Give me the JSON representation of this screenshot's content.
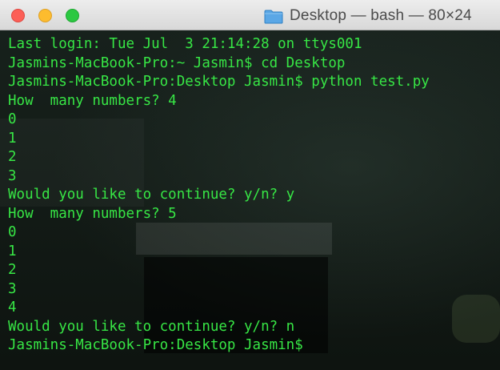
{
  "window": {
    "title": "Desktop — bash — 80×24"
  },
  "terminal": {
    "text_color": "#37e645",
    "lines": [
      "Last login: Tue Jul  3 21:14:28 on ttys001",
      "Jasmins-MacBook-Pro:~ Jasmin$ cd Desktop",
      "Jasmins-MacBook-Pro:Desktop Jasmin$ python test.py",
      "How  many numbers? 4",
      "0",
      "1",
      "2",
      "3",
      "Would you like to continue? y/n? y",
      "How  many numbers? 5",
      "0",
      "1",
      "2",
      "3",
      "4",
      "Would you like to continue? y/n? n",
      "Jasmins-MacBook-Pro:Desktop Jasmin$"
    ]
  }
}
